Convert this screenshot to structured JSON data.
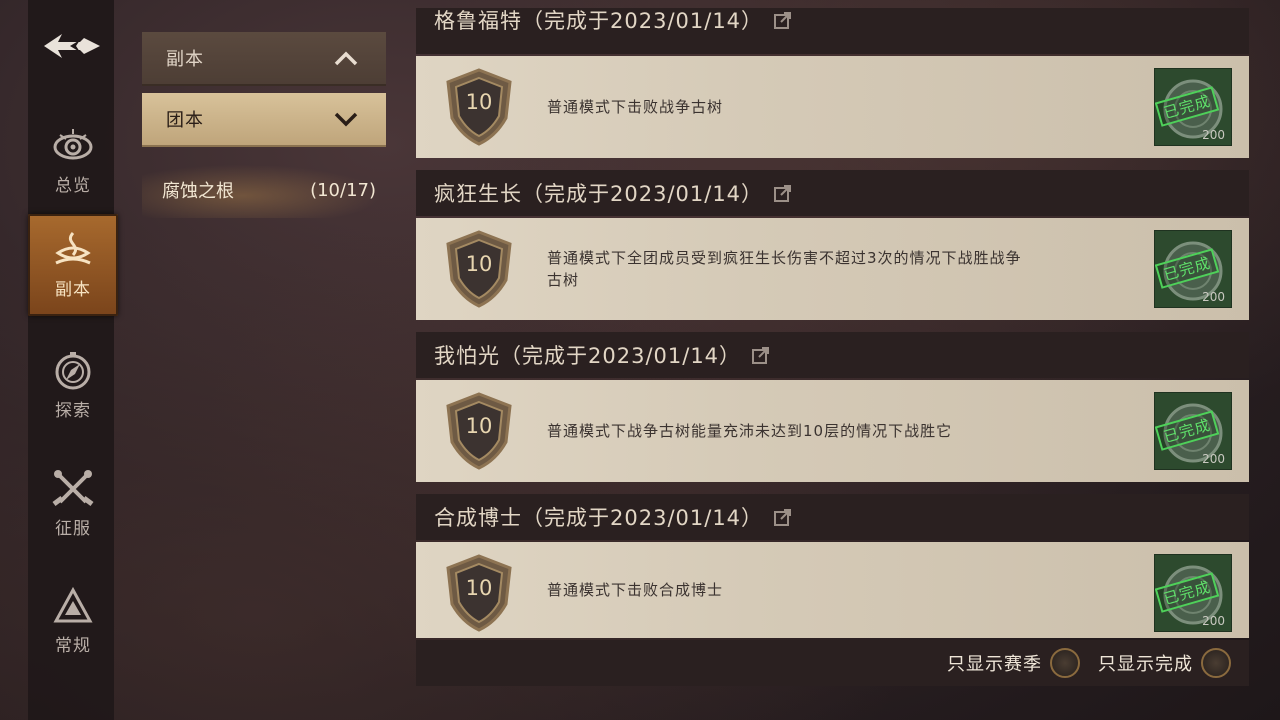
{
  "nav": {
    "items": [
      {
        "label": "总览",
        "icon": "eye-icon"
      },
      {
        "label": "副本",
        "icon": "dungeon-icon"
      },
      {
        "label": "探索",
        "icon": "compass-icon"
      },
      {
        "label": "征服",
        "icon": "crossed-swords-icon"
      },
      {
        "label": "常规",
        "icon": "triangle-icon"
      }
    ],
    "active_index": 1
  },
  "categories": {
    "primary": {
      "label": "副本"
    },
    "secondary": {
      "label": "团本"
    },
    "selected_sub": {
      "name": "腐蚀之根",
      "count": "(10/17)"
    }
  },
  "achievements": [
    {
      "title": "格鲁福特（完成于2023/01/14）",
      "points": "10",
      "desc": "普通模式下击败战争古树",
      "stamp": "已完成",
      "reward": "200"
    },
    {
      "title": "疯狂生长（完成于2023/01/14）",
      "points": "10",
      "desc": "普通模式下全团成员受到疯狂生长伤害不超过3次的情况下战胜战争古树",
      "stamp": "已完成",
      "reward": "200"
    },
    {
      "title": "我怕光（完成于2023/01/14）",
      "points": "10",
      "desc": "普通模式下战争古树能量充沛未达到10层的情况下战胜它",
      "stamp": "已完成",
      "reward": "200"
    },
    {
      "title": "合成博士（完成于2023/01/14）",
      "points": "10",
      "desc": "普通模式下击败合成博士",
      "stamp": "已完成",
      "reward": "200"
    }
  ],
  "footer": {
    "filter_season": "只显示赛季",
    "filter_completed": "只显示完成"
  },
  "colors": {
    "accent": "#a86a2e",
    "card_bg": "#dfd5c3",
    "header_bg": "#2a2020",
    "stamp_green": "#5fe06a"
  }
}
